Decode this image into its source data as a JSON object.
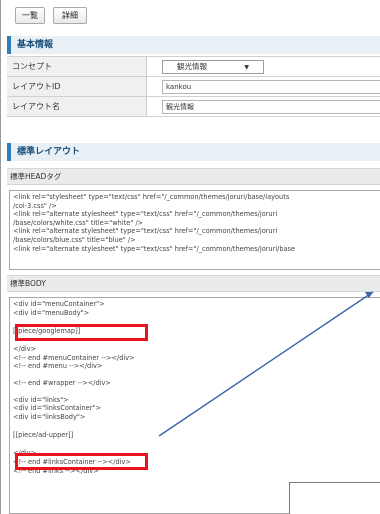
{
  "tabs": {
    "list_label": "一覧",
    "detail_label": "詳細"
  },
  "basic_info": {
    "title": "基本情報",
    "rows": [
      {
        "label": "コンセプト",
        "value": "観光情報",
        "kind": "select"
      },
      {
        "label": "レイアウトID",
        "value": "kankou",
        "kind": "input"
      },
      {
        "label": "レイアウト名",
        "value": "観光情報",
        "kind": "input"
      }
    ]
  },
  "standard_layout": {
    "title": "標準レイアウト",
    "head_label": "標準HEADタグ",
    "head_lines": [
      "<link rel=\"stylesheet\" type=\"text/css\" href=\"/_common/themes/joruri/base/layouts",
      "/col-3.css\" />",
      "<link rel=\"alternate stylesheet\" type=\"text/css\" href=\"/_common/themes/joruri",
      "/base/colors/white.css\" title=\"white\" />",
      "<link rel=\"alternate stylesheet\" type=\"text/css\" href=\"/_common/themes/joruri",
      "/base/colors/blue.css\" title=\"blue\" />",
      "<link rel=\"alternate stylesheet\" type=\"text/css\" href=\"/_common/themes/joruri/base"
    ],
    "body_label": "標準BODY",
    "body_lines_a": [
      "<div id=\"menuContainer\">",
      "<div id=\"menuBody\">"
    ],
    "piece_1": "[[piece/googlemap]]",
    "body_lines_b": [
      "</div>",
      "<!-- end #menuContainer --></div>",
      "<!-- end #menu --></div>"
    ],
    "body_lines_c": [
      "<!-- end #wrapper --></div>"
    ],
    "body_lines_d": [
      "<div id=\"links\">",
      "<div id=\"linksContainer\">",
      "<div id=\"linksBody\">"
    ],
    "piece_2": "[[piece/ad-upper]]",
    "body_lines_e": [
      "</div>",
      "<!-- end #linksContainer --></div>",
      "<!-- end #links --></div>"
    ]
  },
  "colors": {
    "highlight": "#e8131f",
    "accent": "#2f7fb5",
    "arrow": "#3a63a8"
  },
  "icons": {
    "dropdown": "chevron-down-icon"
  }
}
